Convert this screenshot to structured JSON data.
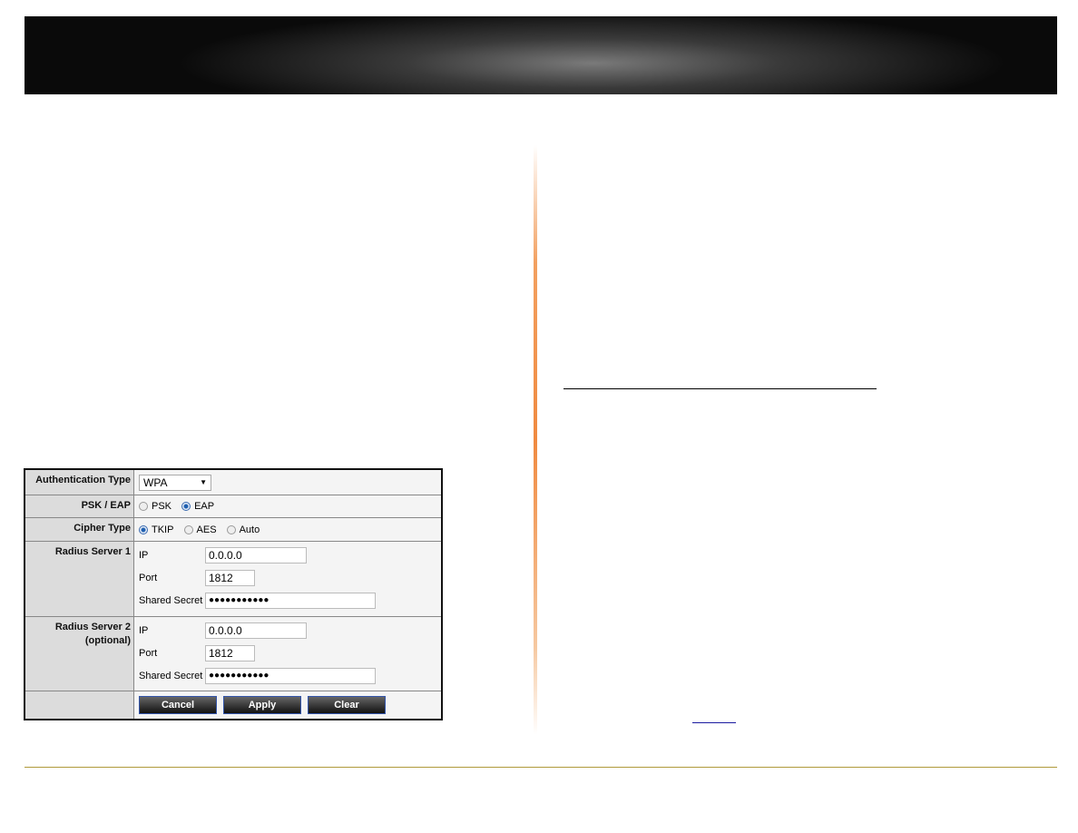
{
  "form": {
    "auth_type": {
      "label": "Authentication Type",
      "value": "WPA"
    },
    "psk_eap": {
      "label": "PSK / EAP",
      "options": [
        "PSK",
        "EAP"
      ],
      "selected": "EAP"
    },
    "cipher": {
      "label": "Cipher Type",
      "options": [
        "TKIP",
        "AES",
        "Auto"
      ],
      "selected": "TKIP"
    },
    "radius1": {
      "label": "Radius Server 1",
      "ip_label": "IP",
      "ip": "0.0.0.0",
      "port_label": "Port",
      "port": "1812",
      "secret_label": "Shared Secret",
      "secret": "●●●●●●●●●●●"
    },
    "radius2": {
      "label": "Radius Server 2",
      "label2": "(optional)",
      "ip_label": "IP",
      "ip": "0.0.0.0",
      "port_label": "Port",
      "port": "1812",
      "secret_label": "Shared Secret",
      "secret": "●●●●●●●●●●●"
    },
    "buttons": {
      "cancel": "Cancel",
      "apply": "Apply",
      "clear": "Clear"
    }
  }
}
